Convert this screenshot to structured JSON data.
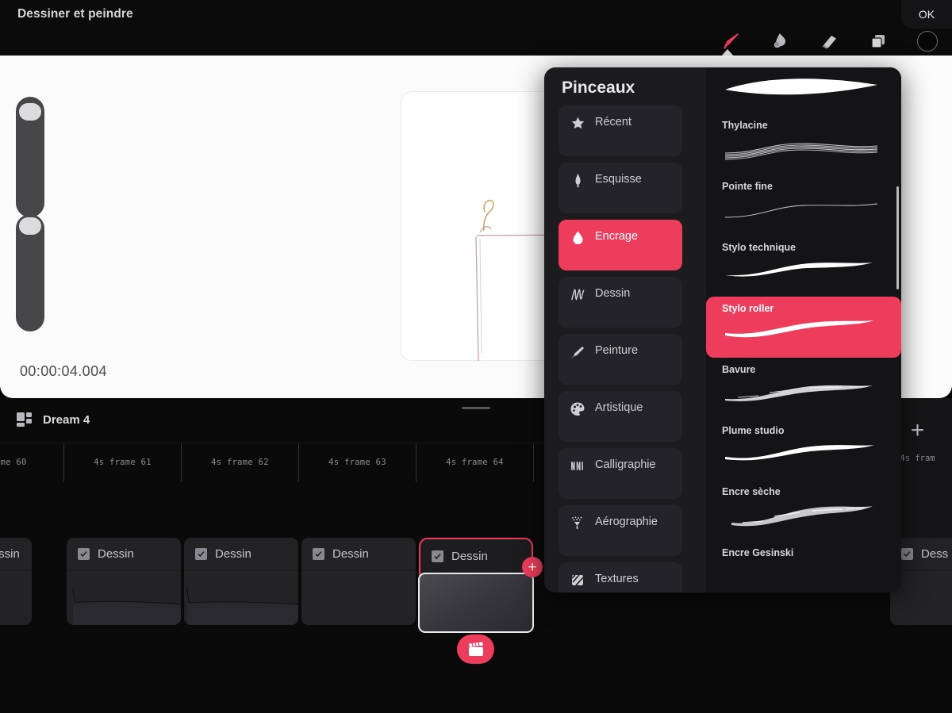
{
  "header": {
    "title": "Dessiner et peindre",
    "ok_label": "OK",
    "tools": [
      {
        "name": "brush-tool",
        "label": "Pinceau",
        "active": true
      },
      {
        "name": "smudge-tool",
        "label": "Estomper",
        "active": false
      },
      {
        "name": "eraser-tool",
        "label": "Gomme",
        "active": false
      },
      {
        "name": "layers-tool",
        "label": "Calques",
        "active": false
      },
      {
        "name": "color-tool",
        "label": "Couleur",
        "active": false
      }
    ]
  },
  "canvas": {
    "timecode": "00:00:04.004",
    "size_slider_label": "Taille",
    "opacity_slider_label": "Opacité"
  },
  "brushes_panel": {
    "title": "Pinceaux",
    "categories": [
      {
        "label": "Récent",
        "icon": "star-icon",
        "active": false
      },
      {
        "label": "Esquisse",
        "icon": "pencil-tip-icon",
        "active": false
      },
      {
        "label": "Encrage",
        "icon": "ink-drop-icon",
        "active": true
      },
      {
        "label": "Dessin",
        "icon": "scribble-icon",
        "active": false
      },
      {
        "label": "Peinture",
        "icon": "paint-brush-icon",
        "active": false
      },
      {
        "label": "Artistique",
        "icon": "palette-icon",
        "active": false
      },
      {
        "label": "Calligraphie",
        "icon": "calligraphy-icon",
        "active": false
      },
      {
        "label": "Aérographie",
        "icon": "airbrush-icon",
        "active": false
      },
      {
        "label": "Textures",
        "icon": "texture-icon",
        "active": false
      }
    ],
    "brushes": [
      {
        "label": "Thylacine",
        "active": false,
        "style": "tapered-solid"
      },
      {
        "label": "Pointe fine",
        "active": false,
        "style": "multi-rough"
      },
      {
        "label": "Stylo technique",
        "active": false,
        "style": "thin-line"
      },
      {
        "label": "Stylo roller",
        "active": true,
        "style": "smooth-taper"
      },
      {
        "label": "Bavure",
        "active": false,
        "style": "grainy"
      },
      {
        "label": "Plume studio",
        "active": false,
        "style": "smooth-taper"
      },
      {
        "label": "Encre sèche",
        "active": false,
        "style": "dry-rough"
      },
      {
        "label": "Encre Gesinski",
        "active": false,
        "style": "none"
      }
    ]
  },
  "timeline": {
    "project_name": "Dream 4",
    "project_icon": "layout-grid-icon",
    "ruler_labels": [
      "rame 60",
      "4s frame 61",
      "4s frame 62",
      "4s frame 63",
      "4s frame 64"
    ],
    "add_frame_label": "+",
    "add_frame_ruler_label": "4s fram",
    "frames": [
      {
        "label": "Dessin",
        "checked": true,
        "selected": false
      },
      {
        "label": "Dessin",
        "checked": true,
        "selected": false
      },
      {
        "label": "Dessin",
        "checked": true,
        "selected": false
      },
      {
        "label": "Dessin",
        "checked": true,
        "selected": false
      },
      {
        "label": "Dessin",
        "checked": true,
        "selected": true
      },
      {
        "label": "Dess",
        "checked": true,
        "selected": false
      }
    ],
    "movie_button_icon": "clapperboard-icon",
    "add_layer_badge": "+"
  },
  "colors": {
    "accent": "#ee3d5c",
    "panel_bg": "#1c1c1f",
    "brush_list_bg": "#141416",
    "app_bg": "#000000",
    "canvas_bg": "#fbfbfb"
  }
}
